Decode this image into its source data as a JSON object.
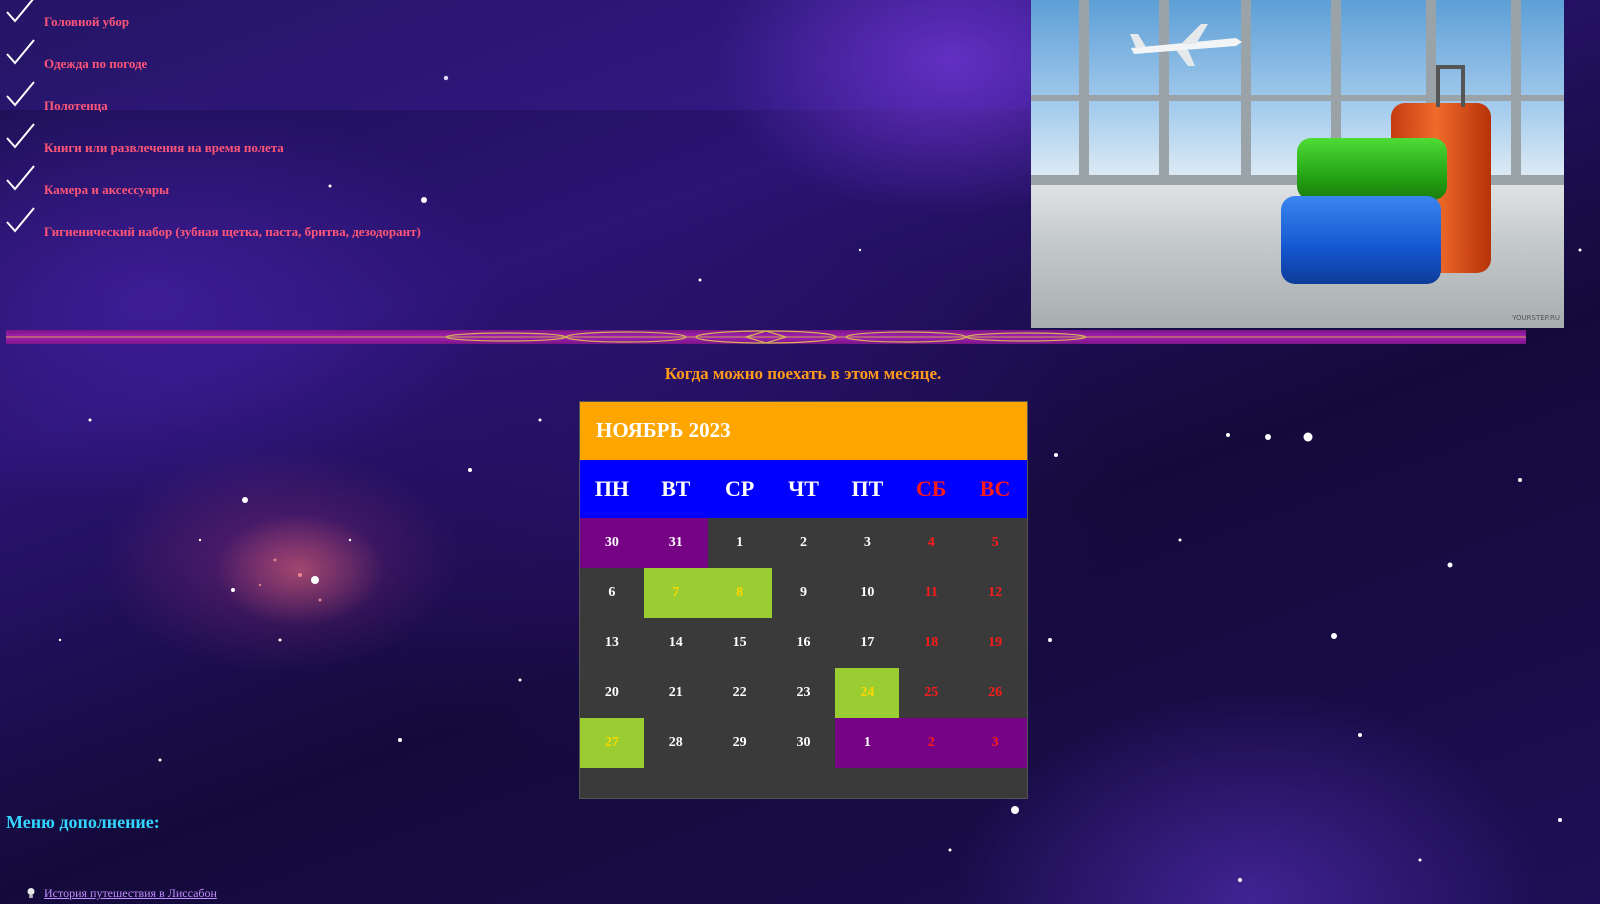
{
  "checklist": {
    "items": [
      {
        "label": "Головной убор"
      },
      {
        "label": "Одежда по погоде"
      },
      {
        "label": "Полотенца"
      },
      {
        "label": "Книги или развлечения на время полета"
      },
      {
        "label": "Камера и аксессуары"
      },
      {
        "label": "Гигиенический набор (зубная щетка, паста, бритва, дезодорант)"
      }
    ],
    "check_icon": "checkmark-icon",
    "text_color": "#ff5577"
  },
  "photo": {
    "watermark": "YOURSTEP.RU"
  },
  "calendar": {
    "heading": "Когда можно поехать в этом месяце.",
    "month_title": "НОЯБРЬ 2023",
    "weekdays": [
      "ПН",
      "ВТ",
      "СР",
      "ЧТ",
      "ПТ",
      "СБ",
      "ВС"
    ],
    "weeks": [
      [
        {
          "d": "30",
          "t": "other"
        },
        {
          "d": "31",
          "t": "other"
        },
        {
          "d": "1",
          "t": ""
        },
        {
          "d": "2",
          "t": ""
        },
        {
          "d": "3",
          "t": ""
        },
        {
          "d": "4",
          "t": "weekend"
        },
        {
          "d": "5",
          "t": "weekend"
        }
      ],
      [
        {
          "d": "6",
          "t": ""
        },
        {
          "d": "7",
          "t": "highlight"
        },
        {
          "d": "8",
          "t": "highlight"
        },
        {
          "d": "9",
          "t": ""
        },
        {
          "d": "10",
          "t": ""
        },
        {
          "d": "11",
          "t": "weekend"
        },
        {
          "d": "12",
          "t": "weekend"
        }
      ],
      [
        {
          "d": "13",
          "t": ""
        },
        {
          "d": "14",
          "t": ""
        },
        {
          "d": "15",
          "t": ""
        },
        {
          "d": "16",
          "t": ""
        },
        {
          "d": "17",
          "t": ""
        },
        {
          "d": "18",
          "t": "weekend"
        },
        {
          "d": "19",
          "t": "weekend"
        }
      ],
      [
        {
          "d": "20",
          "t": ""
        },
        {
          "d": "21",
          "t": ""
        },
        {
          "d": "22",
          "t": ""
        },
        {
          "d": "23",
          "t": ""
        },
        {
          "d": "24",
          "t": "highlight"
        },
        {
          "d": "25",
          "t": "weekend"
        },
        {
          "d": "26",
          "t": "weekend"
        }
      ],
      [
        {
          "d": "27",
          "t": "highlight"
        },
        {
          "d": "28",
          "t": ""
        },
        {
          "d": "29",
          "t": ""
        },
        {
          "d": "30",
          "t": ""
        },
        {
          "d": "1",
          "t": "other"
        },
        {
          "d": "2",
          "t": "other weekend"
        },
        {
          "d": "3",
          "t": "other weekend"
        }
      ]
    ],
    "colors": {
      "header": "#ffa500",
      "weekday_bar": "#0000ff",
      "body": "#3a3a3a",
      "other_month": "#750383",
      "highlight": "#9acd32",
      "weekend_text": "#ff1a1a"
    }
  },
  "menu": {
    "title": "Меню дополнение:",
    "links": [
      {
        "label": "История путешествия в Лиссабон",
        "icon": "lightbulb-icon"
      }
    ]
  }
}
